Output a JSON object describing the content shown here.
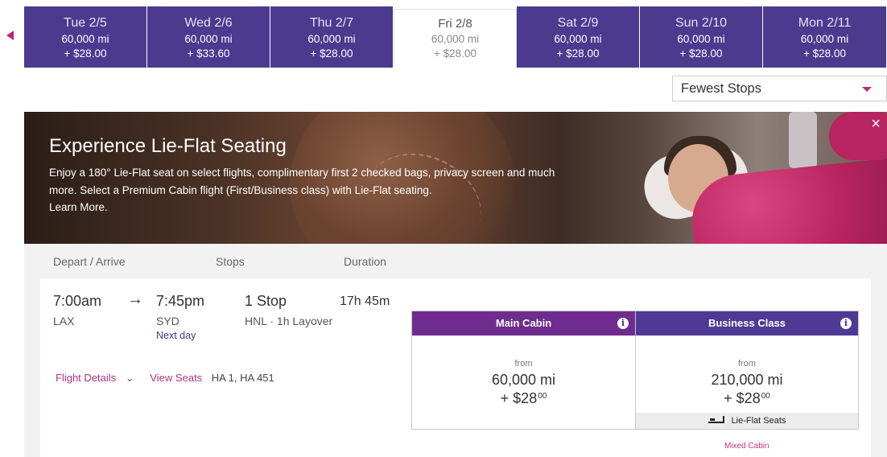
{
  "dates": [
    {
      "day": "Tue 2/5",
      "miles": "60,000 mi",
      "price": "+ $28.00",
      "active": false
    },
    {
      "day": "Wed 2/6",
      "miles": "60,000 mi",
      "price": "+ $33.60",
      "active": false
    },
    {
      "day": "Thu 2/7",
      "miles": "60,000 mi",
      "price": "+ $28.00",
      "active": false
    },
    {
      "day": "Fri 2/8",
      "miles": "60,000 mi",
      "price": "+ $28.00",
      "active": true
    },
    {
      "day": "Sat 2/9",
      "miles": "60,000 mi",
      "price": "+ $28.00",
      "active": false
    },
    {
      "day": "Sun 2/10",
      "miles": "60,000 mi",
      "price": "+ $28.00",
      "active": false
    },
    {
      "day": "Mon 2/11",
      "miles": "60,000 mi",
      "price": "+ $28.00",
      "active": false
    }
  ],
  "sort": {
    "selected": "Fewest Stops"
  },
  "banner": {
    "title": "Experience Lie-Flat Seating",
    "body": "Enjoy a 180° Lie-Flat seat on select flights, complimentary first 2 checked bags, privacy screen and much more. Select a Premium Cabin flight (First/Business class) with Lie-Flat seating.",
    "link": "Learn More.",
    "close": "×"
  },
  "columns": {
    "depart_arrive": "Depart / Arrive",
    "stops": "Stops",
    "duration": "Duration"
  },
  "flight": {
    "depart_time": "7:00am",
    "arrow": "→",
    "arrive_time": "7:45pm",
    "origin": "LAX",
    "destination": "SYD",
    "next_day": "Next day",
    "stops": "1 Stop",
    "layover": "HNL · 1h Layover",
    "duration": "17h 45m",
    "details_link": "Flight Details",
    "details_caret": "⌄",
    "seats_link": "View Seats",
    "flight_numbers": "HA 1, HA 451"
  },
  "fares": {
    "main": {
      "cabin": "Main Cabin",
      "from": "from",
      "miles": "60,000 mi",
      "price": "+ $28",
      "cents": "00"
    },
    "business": {
      "cabin": "Business Class",
      "from": "from",
      "miles": "210,000 mi",
      "price": "+ $28",
      "cents": "00",
      "feature": "Lie-Flat Seats",
      "note": "Mixed Cabin"
    },
    "info_icon": "i"
  },
  "colors": {
    "accent": "#c0257a",
    "date_tab": "#4b3a8e",
    "main_cabin": "#6e2d8e",
    "business": "#4e3a94"
  }
}
